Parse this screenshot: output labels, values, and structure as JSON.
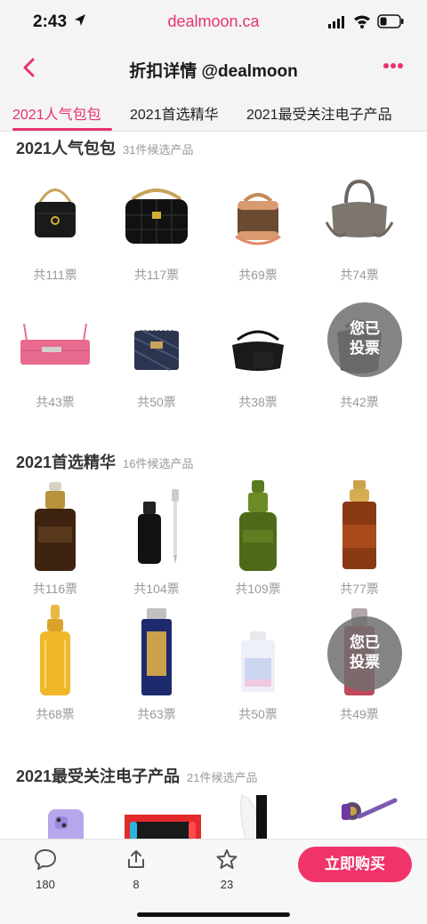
{
  "status_bar": {
    "time": "2:43",
    "url": "dealmoon.ca"
  },
  "nav": {
    "title": "折扣详情 @dealmoon"
  },
  "tabs": [
    {
      "label": "2021人气包包",
      "active": true
    },
    {
      "label": "2021首选精华",
      "active": false
    },
    {
      "label": "2021最受关注电子产品",
      "active": false
    }
  ],
  "sections": [
    {
      "name": "2021人气包包",
      "count": "31件候选产品",
      "items": [
        {
          "image": "chanel-black-mini-bag",
          "votes": "共111票"
        },
        {
          "image": "black-quilted-chain-bag",
          "votes": "共117票"
        },
        {
          "image": "monogram-brown-barrel-bag",
          "votes": "共69票"
        },
        {
          "image": "taupe-leather-lindy-bag",
          "votes": "共74票"
        },
        {
          "image": "pink-clutch-bag",
          "votes": "共43票"
        },
        {
          "image": "dior-oblique-bag",
          "votes": "共50票"
        },
        {
          "image": "black-nylon-hobo-bag",
          "votes": "共38票"
        },
        {
          "image": "monogram-hobo-bag",
          "votes": "共42票",
          "voted": "您已投票"
        }
      ]
    },
    {
      "name": "2021首选精华",
      "count": "16件候选产品",
      "items": [
        {
          "image": "brown-serum-bottle",
          "votes": "共116票"
        },
        {
          "image": "black-serum-with-dropper",
          "votes": "共104票"
        },
        {
          "image": "green-serum-bottle",
          "votes": "共109票"
        },
        {
          "image": "amber-serum-pump",
          "votes": "共77票"
        },
        {
          "image": "gold-oil-bottle",
          "votes": "共68票"
        },
        {
          "image": "navy-serum-bottle",
          "votes": "共63票"
        },
        {
          "image": "clear-serum-bottle",
          "votes": "共50票"
        },
        {
          "image": "red-serum-bottle",
          "votes": "共49票",
          "voted": "您已投票"
        }
      ]
    },
    {
      "name": "2021最受关注电子产品",
      "count": "21件候选产品",
      "items": [
        {
          "image": "purple-phone"
        },
        {
          "image": "game-console-box"
        },
        {
          "image": "white-game-console"
        },
        {
          "image": "cordless-vacuum"
        }
      ]
    }
  ],
  "bottom_bar": {
    "comments": "180",
    "shares": "8",
    "favorites": "23",
    "buy_label": "立即购买"
  },
  "colors": {
    "accent": "#e8336d",
    "buy_button": "#f0346a"
  }
}
